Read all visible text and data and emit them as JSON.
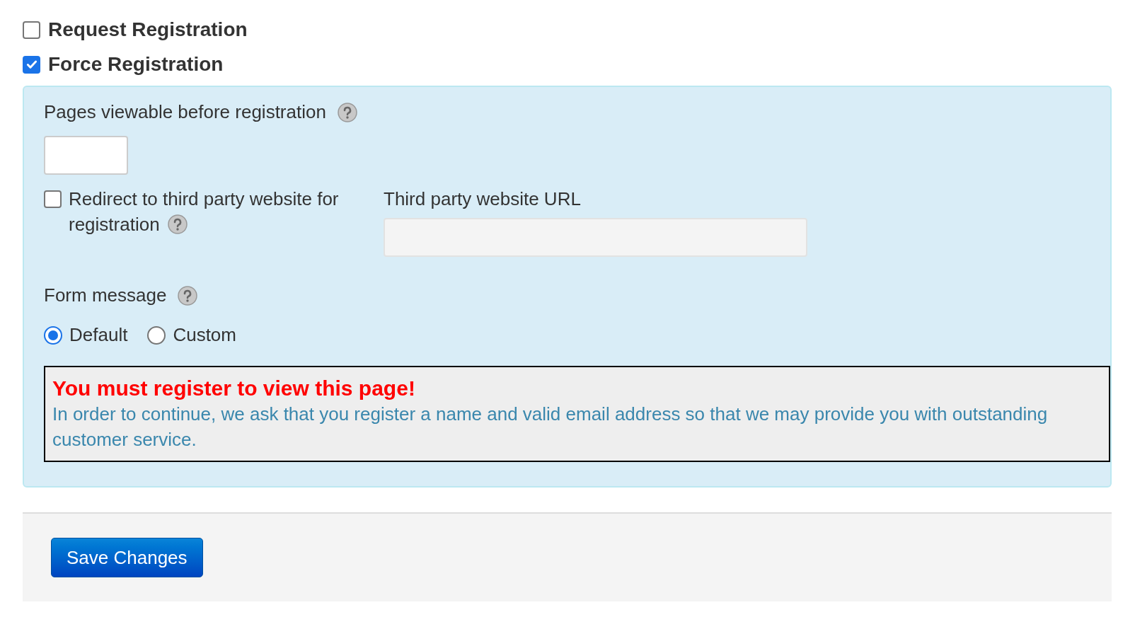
{
  "options": [
    {
      "label": "Request Registration",
      "checked": false
    },
    {
      "label": "Force Registration",
      "checked": true
    }
  ],
  "panel": {
    "pages_viewable": {
      "label": "Pages viewable before registration"
    },
    "redirect": {
      "label": "Redirect to third party website for registration",
      "checked": false
    },
    "url_field": {
      "label": "Third party website URL",
      "disabled": true
    },
    "form_message": {
      "label": "Form message",
      "options": [
        {
          "label": "Default",
          "selected": true
        },
        {
          "label": "Custom",
          "selected": false
        }
      ]
    },
    "message": {
      "heading": "You must register to view this page!",
      "body": "In order to continue, we ask that you register a name and valid email address so that we may provide you with outstanding customer service."
    }
  },
  "save_button": "Save Changes"
}
